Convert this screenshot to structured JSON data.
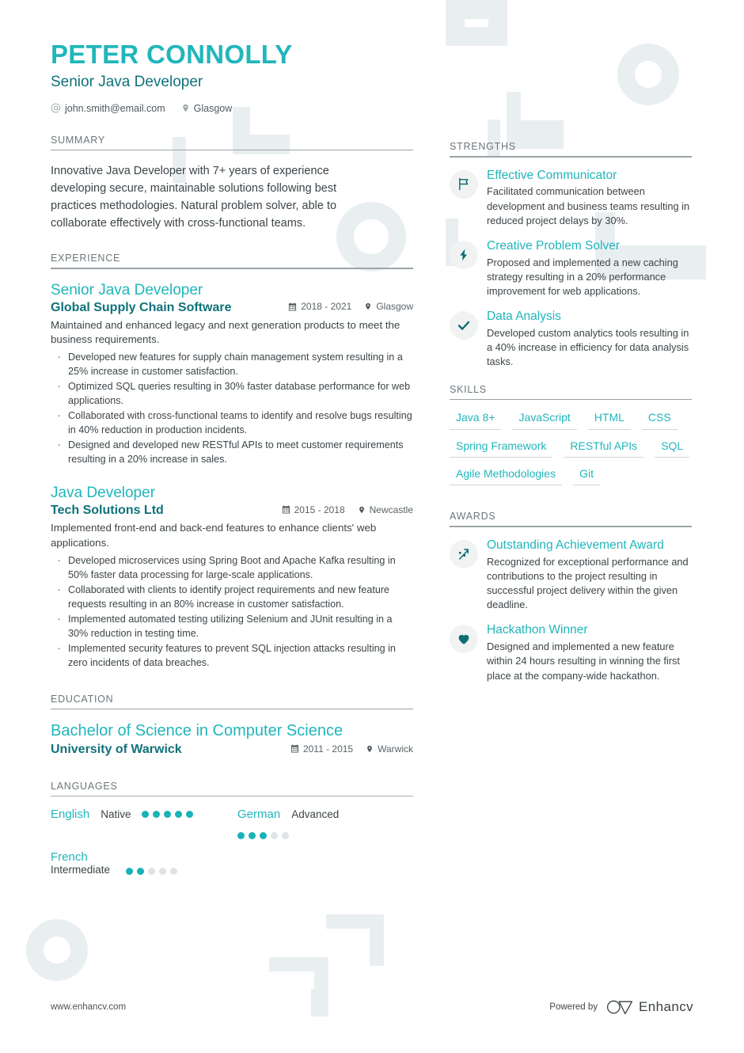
{
  "colors": {
    "accent": "#21b6bb",
    "accent_dark": "#0f7279",
    "text": "#3d4548",
    "muted": "#6d767b",
    "watermark": "#e9eff1",
    "dot_on": "#18b3b8",
    "dot_off": "#dfe3e5"
  },
  "header": {
    "name": "PETER CONNOLLY",
    "role": "Senior Java Developer",
    "email": "john.smith@email.com",
    "email_icon": "at-icon",
    "location": "Glasgow",
    "location_icon": "map-pin-icon"
  },
  "summary": {
    "heading": "SUMMARY",
    "text": "Innovative Java Developer with 7+ years of experience developing secure, maintainable solutions following best practices methodologies. Natural problem solver, able to collaborate effectively with cross-functional teams."
  },
  "experience": {
    "heading": "EXPERIENCE",
    "jobs": [
      {
        "title": "Senior Java Developer",
        "company": "Global Supply Chain Software",
        "dates": "2018 - 2021",
        "location": "Glasgow",
        "description": "Maintained and enhanced legacy and next generation products to meet the business requirements.",
        "bullets": [
          "Developed new features for supply chain management system resulting in a 25% increase in customer satisfaction.",
          "Optimized SQL queries resulting in 30% faster database performance for web applications.",
          "Collaborated with cross-functional teams to identify and resolve bugs resulting in 40% reduction in production incidents.",
          "Designed and developed new RESTful APIs to meet customer requirements resulting in a 20% increase in sales."
        ]
      },
      {
        "title": "Java Developer",
        "company": "Tech Solutions Ltd",
        "dates": "2015 - 2018",
        "location": "Newcastle",
        "description": "Implemented front-end and back-end features to enhance clients' web applications.",
        "bullets": [
          "Developed microservices using Spring Boot and Apache Kafka resulting in 50% faster data processing for large-scale applications.",
          "Collaborated with clients to identify project requirements and new feature requests resulting in an 80% increase in customer satisfaction.",
          "Implemented automated testing utilizing Selenium and JUnit resulting in a 30% reduction in testing time.",
          "Implemented security features to prevent SQL injection attacks resulting in zero incidents of data breaches."
        ]
      }
    ]
  },
  "education": {
    "heading": "EDUCATION",
    "entries": [
      {
        "degree": "Bachelor of Science in Computer Science",
        "school": "University of Warwick",
        "dates": "2011 - 2015",
        "location": "Warwick"
      }
    ]
  },
  "languages": {
    "heading": "LANGUAGES",
    "items": [
      {
        "name": "English",
        "level": "Native",
        "filled": 5,
        "total": 5
      },
      {
        "name": "German",
        "level": "Advanced",
        "filled": 3,
        "total": 5
      },
      {
        "name": "French",
        "level": "Intermediate",
        "filled": 2,
        "total": 5
      }
    ]
  },
  "strengths": {
    "heading": "STRENGTHS",
    "items": [
      {
        "icon": "flag-icon",
        "title": "Effective Communicator",
        "description": "Facilitated communication between development and business teams resulting in reduced project delays by 30%."
      },
      {
        "icon": "lightning-bolt-icon",
        "title": "Creative Problem Solver",
        "description": "Proposed and implemented a new caching strategy resulting in a 20% performance improvement for web applications."
      },
      {
        "icon": "check-icon",
        "title": "Data Analysis",
        "description": "Developed custom analytics tools resulting in a 40% increase in efficiency for data analysis tasks."
      }
    ]
  },
  "skills": {
    "heading": "SKILLS",
    "items": [
      "Java 8+",
      "JavaScript",
      "HTML",
      "CSS",
      "Spring Framework",
      "RESTful APIs",
      "SQL",
      "Agile Methodologies",
      "Git"
    ]
  },
  "awards": {
    "heading": "AWARDS",
    "items": [
      {
        "icon": "trend-arrow-icon",
        "title": "Outstanding Achievement Award",
        "description": "Recognized for exceptional performance and contributions to the project resulting in successful project delivery within the given deadline."
      },
      {
        "icon": "heart-icon",
        "title": "Hackathon Winner",
        "description": "Designed and implemented a new feature within 24 hours resulting in winning the first place at the company-wide hackathon."
      }
    ]
  },
  "footer": {
    "url": "www.enhancv.com",
    "powered_by": "Powered by",
    "brand": "Enhancv",
    "brand_icon": "enhancv-logo-icon"
  }
}
